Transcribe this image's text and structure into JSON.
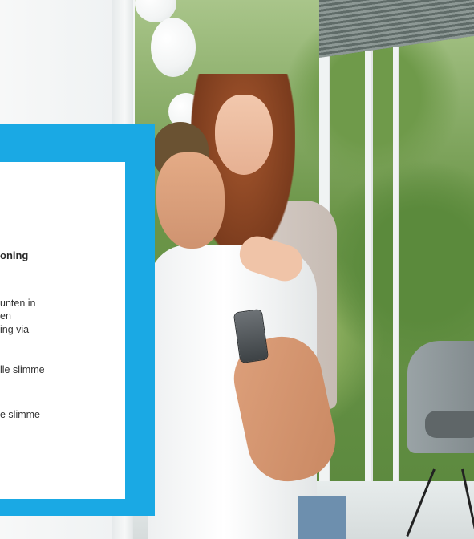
{
  "hero": {
    "card": {
      "heading_fragment": "oning",
      "text_fragments": [
        "unten in",
        "en",
        "ing via",
        "lle slimme",
        "e slimme"
      ]
    },
    "colors": {
      "accent_panel": "#1aa9e4",
      "card_background": "#ffffff",
      "text": "#333333"
    },
    "image": {
      "subject": "couple-with-smartphone-at-window"
    }
  }
}
